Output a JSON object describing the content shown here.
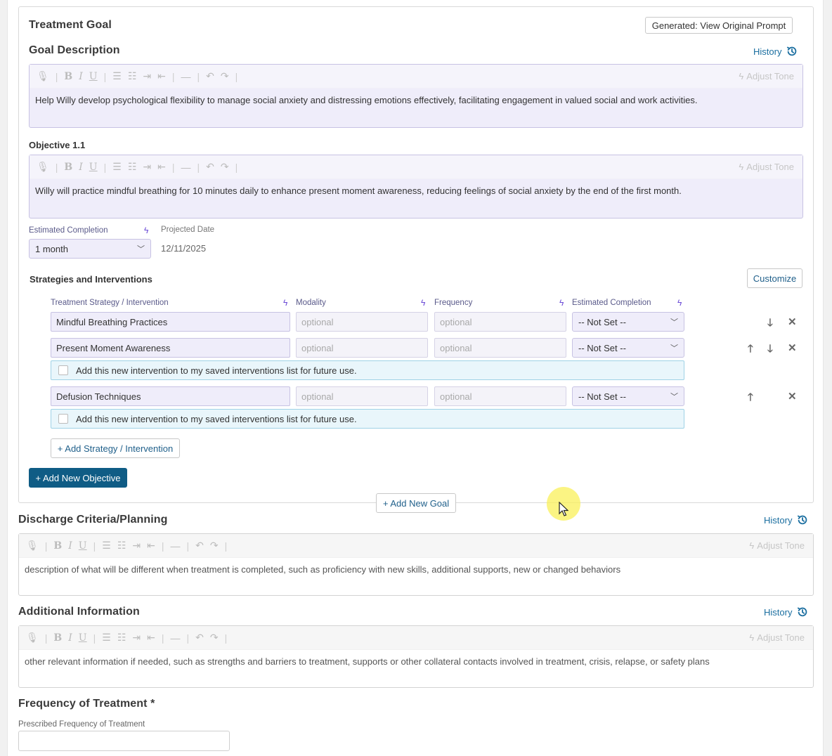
{
  "goal": {
    "title": "Treatment Goal",
    "generated_button": "Generated: View Original Prompt",
    "description_label": "Goal Description",
    "history_label": "History",
    "description_text": "Help Willy develop psychological flexibility to manage social anxiety and distressing emotions effectively, facilitating engagement in valued social and work activities."
  },
  "editor_toolbar": {
    "adjust_tone": "Adjust Tone"
  },
  "objective": {
    "label": "Objective 1.1",
    "text": "Willy will practice mindful breathing for 10 minutes daily to enhance present moment awareness, reducing feelings of social anxiety by the end of the first month.",
    "estimated_completion_label": "Estimated Completion",
    "estimated_completion_value": "1 month",
    "projected_date_label": "Projected Date",
    "projected_date_value": "12/11/2025"
  },
  "strategies": {
    "title": "Strategies and Interventions",
    "customize_button": "Customize",
    "columns": [
      "Treatment Strategy / Intervention",
      "Modality",
      "Frequency",
      "Estimated Completion"
    ],
    "placeholder": "optional",
    "not_set": "-- Not Set --",
    "rows": [
      {
        "name": "Mindful Breathing Practices"
      },
      {
        "name": "Present Moment Awareness"
      },
      {
        "name": "Defusion Techniques"
      }
    ],
    "save_prompt": "Add this new intervention to my saved interventions list for future use.",
    "add_strategy_button": "+ Add Strategy / Intervention"
  },
  "add_objective_button": "+ Add New Objective",
  "add_goal_button": "+ Add New Goal",
  "discharge": {
    "title": "Discharge Criteria/Planning",
    "history_label": "History",
    "placeholder": "description of what will be different when treatment is completed, such as proficiency with new skills, additional supports, new or changed behaviors"
  },
  "additional": {
    "title": "Additional Information",
    "history_label": "History",
    "placeholder": "other relevant information if needed, such as strengths and barriers to treatment, supports or other collateral contacts involved in treatment, crisis, relapse, or safety plans"
  },
  "frequency": {
    "title": "Frequency of Treatment *",
    "field_label": "Prescribed Frequency of Treatment",
    "value": ""
  },
  "colors": {
    "accent": "#0f5c85",
    "editor_bg": "#efedfa",
    "link": "#1a6ea0",
    "bolt": "#6b4bd6"
  }
}
